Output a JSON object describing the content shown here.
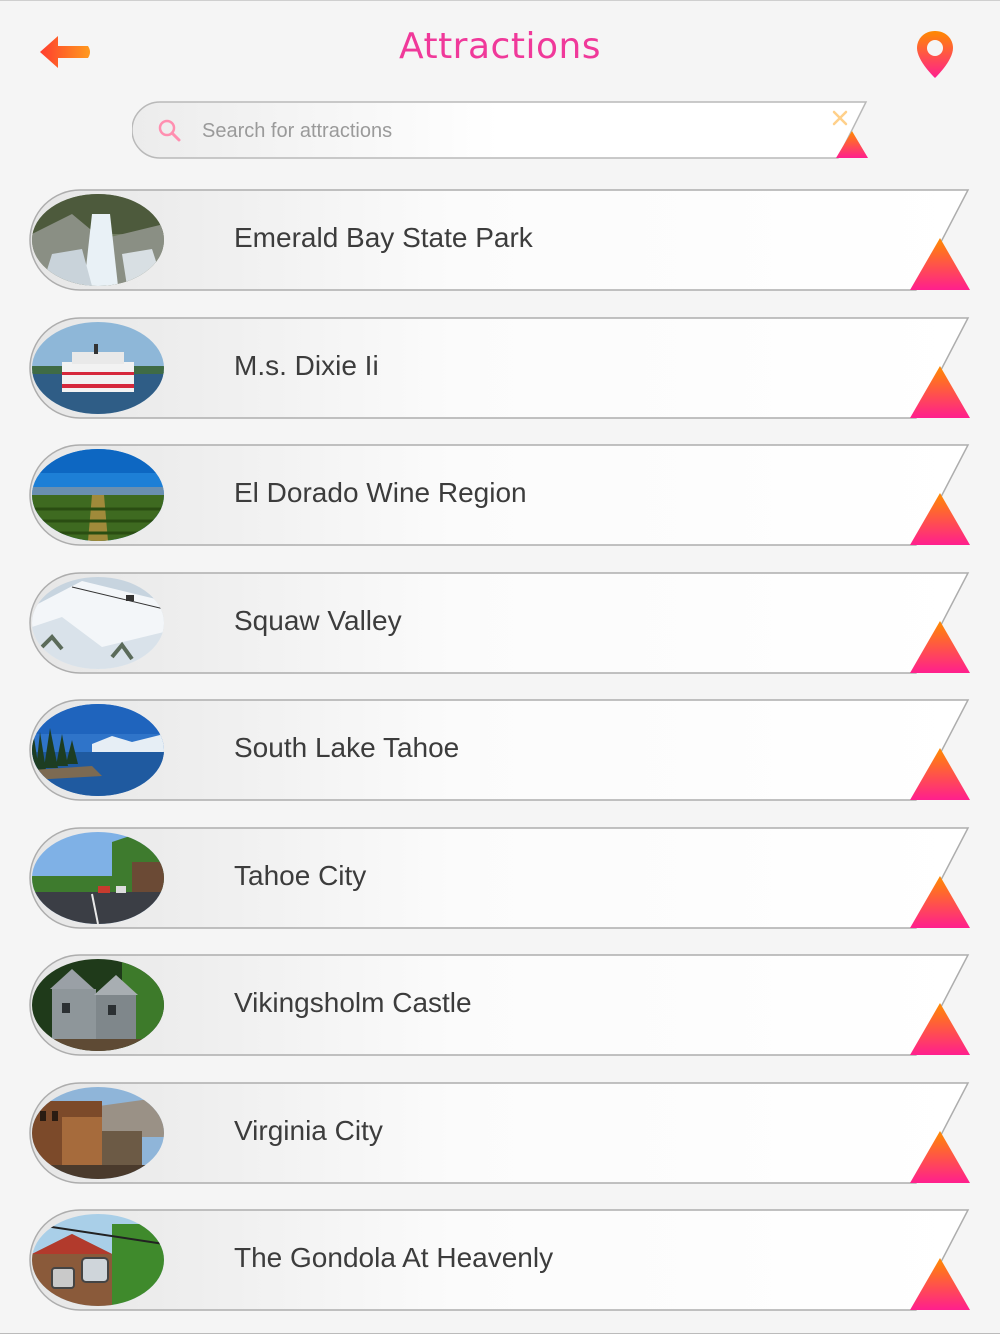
{
  "header": {
    "title": "Attractions",
    "accent_color": "#f0399a",
    "back_icon": "back-arrow-icon",
    "map_icon": "map-pin-icon"
  },
  "search": {
    "placeholder": "Search for attractions",
    "value": ""
  },
  "attractions": [
    {
      "name": "Emerald Bay State Park",
      "image": "waterfall"
    },
    {
      "name": "M.s. Dixie Ii",
      "image": "paddle-steamer"
    },
    {
      "name": "El Dorado Wine Region",
      "image": "vineyard"
    },
    {
      "name": "Squaw Valley",
      "image": "snowy-mountain"
    },
    {
      "name": "South Lake Tahoe",
      "image": "lake-shore"
    },
    {
      "name": "Tahoe City",
      "image": "town-street"
    },
    {
      "name": "Vikingsholm Castle",
      "image": "stone-castle"
    },
    {
      "name": "Virginia City",
      "image": "old-west-street"
    },
    {
      "name": "The Gondola At Heavenly",
      "image": "gondola"
    }
  ],
  "colors": {
    "gradient_start": "#ff8a00",
    "gradient_end": "#ff1f8e",
    "text": "#3c3c3c"
  }
}
